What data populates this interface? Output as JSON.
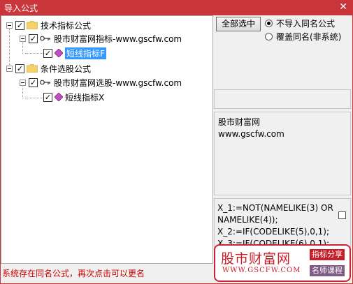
{
  "window": {
    "title": "导入公式",
    "close_glyph": "✕"
  },
  "tree": [
    {
      "label": "技术指标公式",
      "checked": true
    },
    {
      "label": "股市财富网指标-www.gscfw.com",
      "checked": true
    },
    {
      "label": "短线指标F",
      "checked": true,
      "selected": true
    },
    {
      "label": "条件选股公式",
      "checked": true
    },
    {
      "label": "股市财富网选股-www.gscfw.com",
      "checked": true
    },
    {
      "label": "短线指标X",
      "checked": true
    }
  ],
  "controls": {
    "select_all_label": "全部选中",
    "radio_skip_label": "不导入同名公式",
    "radio_overwrite_label": "覆盖同名(非系统)",
    "radio_selected": "skip"
  },
  "info_panel": {
    "line1": "股市财富网",
    "line2": "www.gscfw.com"
  },
  "code_panel": {
    "lines": [
      "X_1:=NOT(NAMELIKE(3) OR",
      "NAMELIKE(4));",
      "X_2:=IF(CODELIKE(5),0,1);",
      "X_3:=IF(CODELIKE(6),0,1);"
    ]
  },
  "status": "系统存在同名公式，再次点击可以更名",
  "watermark": {
    "name_cn": "股市财富网",
    "url": "WWW.GSCFW.COM",
    "tag1": "指标分享",
    "tag2": "名师课程"
  },
  "colors": {
    "titlebar": "#c8353a",
    "selection": "#3399ff",
    "status_text": "#cc0000",
    "brand_red": "#c81e28"
  },
  "icons": {
    "folder": "folder-icon",
    "formula_group": "key-icon",
    "formula": "diamond-formula-icon"
  }
}
